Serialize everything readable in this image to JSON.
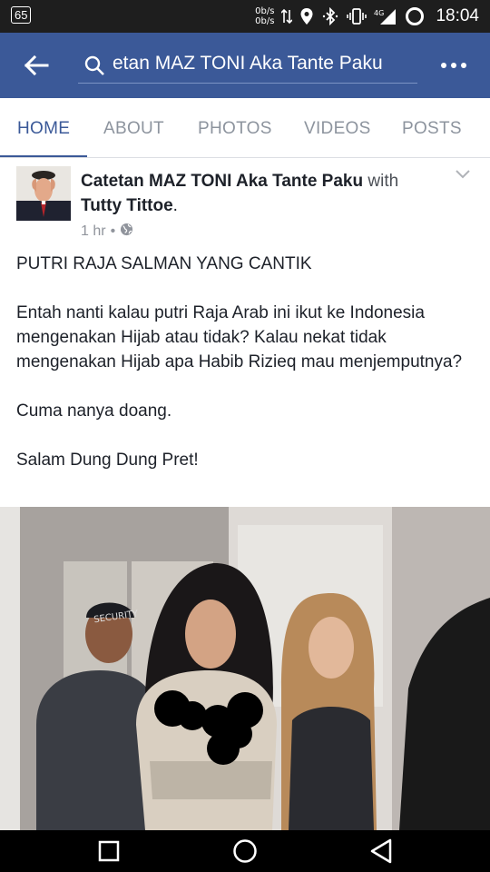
{
  "status_bar": {
    "badge": "65",
    "net_up": "0b/s",
    "net_down": "0b/s",
    "network_type": "4G",
    "time": "18:04"
  },
  "appbar": {
    "search_text": "etan MAZ TONI Aka Tante Paku",
    "background_color": "#3b5998"
  },
  "tabs": [
    {
      "label": "HOME",
      "active": true
    },
    {
      "label": "ABOUT",
      "active": false
    },
    {
      "label": "PHOTOS",
      "active": false
    },
    {
      "label": "VIDEOS",
      "active": false
    },
    {
      "label": "POSTS",
      "active": false
    }
  ],
  "post": {
    "author": "Catetan MAZ TONI Aka Tante Paku",
    "with_text": "with",
    "tagged": "Tutty Tittoe",
    "tagged_suffix": ".",
    "time": "1 hr",
    "separator": "•",
    "privacy_icon": "globe-icon",
    "paragraphs": [
      "PUTRI RAJA SALMAN YANG CANTIK",
      "Entah nanti kalau putri Raja Arab ini ikut ke Indonesia mengenakan Hijab atau tidak? Kalau nekat tidak mengenakan Hijab apa Habib Rizieq mau menjemputnya?",
      "Cuma nanya doang.",
      "Salam Dung Dung Pret!"
    ],
    "photo_caption_text": "SECURITY"
  }
}
